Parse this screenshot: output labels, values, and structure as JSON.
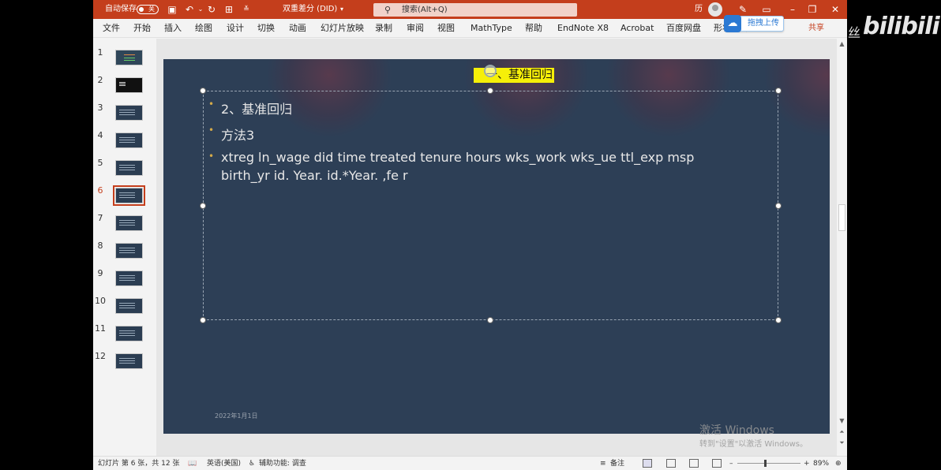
{
  "titlebar": {
    "autosave_label": "自动保存",
    "autosave_state": "关",
    "doc_title": "双重差分 (DID)",
    "search_placeholder": "搜索(Alt+Q)",
    "user_initial": "历",
    "upload_label": "拖拽上传"
  },
  "ribbon": {
    "tabs": [
      "文件",
      "开始",
      "插入",
      "绘图",
      "设计",
      "切换",
      "动画",
      "幻灯片放映",
      "录制",
      "审阅",
      "视图",
      "MathType",
      "帮助",
      "EndNote X8",
      "Acrobat",
      "百度网盘",
      "形状格式"
    ],
    "share_label": "共享"
  },
  "thumbnails": {
    "numbers": [
      "1",
      "2",
      "3",
      "4",
      "5",
      "6",
      "7",
      "8",
      "9",
      "10",
      "11",
      "12"
    ],
    "selected": "6"
  },
  "slide": {
    "title": "一、基准回归",
    "bullets": [
      "2、基准回归",
      "方法3"
    ],
    "code_line1": "xtreg ln_wage  did time treated tenure hours wks_work wks_ue ttl_exp msp",
    "code_line2": "birth_yr id. Year. id.*Year. ,fe r",
    "date": "2022年1月1日"
  },
  "status": {
    "slide_info": "幻灯片 第 6 张，共 12 张",
    "language": "英语(美国)",
    "accessibility": "辅助功能: 调查",
    "notes": "备注",
    "zoom": "89%"
  },
  "watermark": {
    "line1": "激活 Windows",
    "line2": "转到\"设置\"以激活 Windows。"
  },
  "overlay": {
    "logo_prefix": "丝",
    "logo": "bilibili"
  },
  "colors": {
    "titlebar": "#c43e1c",
    "slide_bg": "#2d3f56",
    "title_highlight": "#f6ef08"
  }
}
